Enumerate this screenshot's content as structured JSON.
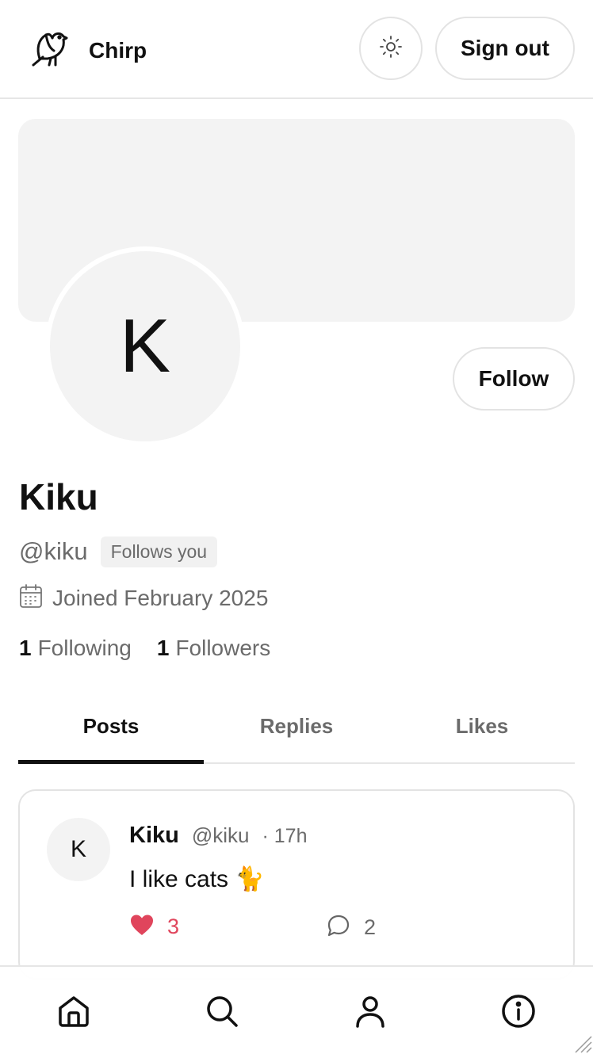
{
  "header": {
    "app_name": "Chirp",
    "logo_icon": "bird-icon",
    "theme_toggle_icon": "sun-icon",
    "sign_out_label": "Sign out"
  },
  "profile": {
    "avatar_initial": "K",
    "follow_label": "Follow",
    "display_name": "Kiku",
    "handle": "@kiku",
    "follows_you_badge": "Follows you",
    "joined": "Joined February 2025",
    "following_count": "1",
    "following_label": "Following",
    "followers_count": "1",
    "followers_label": "Followers"
  },
  "tabs": [
    {
      "label": "Posts",
      "active": true
    },
    {
      "label": "Replies",
      "active": false
    },
    {
      "label": "Likes",
      "active": false
    }
  ],
  "posts": [
    {
      "avatar_initial": "K",
      "author_name": "Kiku",
      "author_handle": "@kiku",
      "time": "· 17h",
      "text": "I like cats 🐈",
      "likes": "3",
      "liked": true,
      "comments": "2"
    }
  ],
  "bottom_nav": {
    "items": [
      "home-icon",
      "search-icon",
      "profile-icon",
      "info-icon"
    ]
  },
  "colors": {
    "like": "#e0455c",
    "muted_text": "#6b6b6b",
    "surface": "#f3f3f3",
    "border": "#e3e3e3"
  }
}
